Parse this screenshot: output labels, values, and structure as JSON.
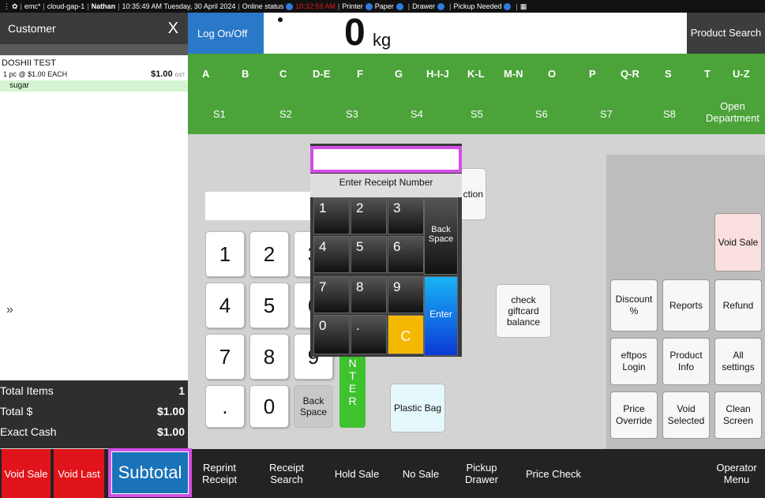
{
  "status_bar": {
    "app": "emc*",
    "host": "cloud-gap-1",
    "user": "Nathan",
    "datetime": "10:35:49 AM Tuesday, 30 April 2024",
    "online_status_label": "Online status",
    "red_time": "10:32:59 AM",
    "printer_label": "Printer",
    "paper_label": "Paper",
    "drawer_label": "Drawer",
    "pickup_label": "Pickup Needed"
  },
  "customer_panel": {
    "title": "Customer",
    "close": "X",
    "sale_name": "DOSHII TEST",
    "line": {
      "desc": "1 pc @ $1.00 EACH",
      "amount": "$1.00",
      "tax": "GST",
      "item": "sugar"
    },
    "collapse": "»"
  },
  "totals": {
    "items_label": "Total Items",
    "items_value": "1",
    "total_label": "Total $",
    "total_value": "$1.00",
    "cash_label": "Exact Cash",
    "cash_value": "$1.00"
  },
  "top": {
    "logon": "Log On/Off",
    "scale_value": "0",
    "scale_unit": "kg",
    "product_search": "Product Search"
  },
  "alpha_keys": [
    "A",
    "B",
    "C",
    "D-E",
    "F",
    "G",
    "H-I-J",
    "K-L",
    "M-N",
    "O",
    "P",
    "Q-R",
    "S",
    "T",
    "U-Z"
  ],
  "dept_keys": [
    "S1",
    "S2",
    "S3",
    "S4",
    "S5",
    "S6",
    "S7",
    "S8",
    "Open Department"
  ],
  "keypad": {
    "digits": [
      "1",
      "2",
      "3",
      "4",
      "5",
      "6",
      "7",
      "8",
      "9",
      ".",
      "0"
    ],
    "back_space": "Back Space",
    "enter_letters": "N\nT\nE\nR"
  },
  "action_buttons": {
    "fuel": "fuel ction",
    "check_giftcard": "check giftcard balance",
    "plastic_bag": "Plastic Bag"
  },
  "right_grid": {
    "void_sale": "Void Sale",
    "discount": "Discount %",
    "reports": "Reports",
    "refund": "Refund",
    "eftpos": "eftpos Login",
    "product_info": "Product Info",
    "all_settings": "All settings",
    "price_override": "Price Override",
    "void_selected": "Void Selected",
    "clean_screen": "Clean Screen"
  },
  "popup": {
    "input_value": "",
    "label": "Enter Receipt Number",
    "keys": [
      "1",
      "2",
      "3",
      "4",
      "5",
      "6",
      "7",
      "8",
      "9",
      "0",
      "."
    ],
    "back_space": "Back Space",
    "clear": "C",
    "enter": "Enter"
  },
  "bottom_bar": {
    "void_sale": "Void Sale",
    "void_last": "Void Last",
    "subtotal": "Subtotal",
    "reprint_receipt": "Reprint Receipt",
    "receipt_search": "Receipt Search",
    "hold_sale": "Hold Sale",
    "no_sale": "No Sale",
    "pickup_drawer": "Pickup Drawer",
    "price_check": "Price Check",
    "operator_menu": "Operator Menu"
  },
  "colors": {
    "green": "#4ba339",
    "blue": "#2a78c8",
    "red": "#e1141b",
    "highlight": "#d24ee6"
  }
}
